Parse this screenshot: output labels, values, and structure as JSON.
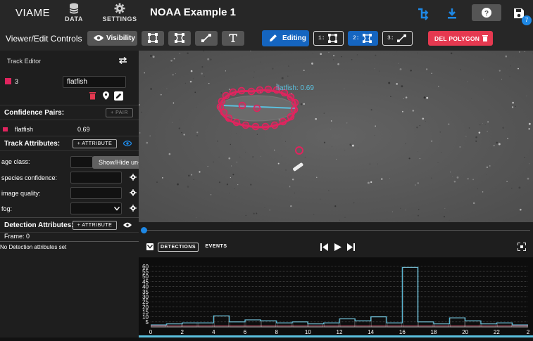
{
  "header": {
    "brand": "VIAME",
    "nav": [
      {
        "label": "DATA"
      },
      {
        "label": "SETTINGS"
      }
    ],
    "title": "NOAA Example 1",
    "badge": "7"
  },
  "toolbar": {
    "label": "Viewer/Edit Controls",
    "visibility_label": "Visibility",
    "editing_label": "Editing",
    "mode_buttons": [
      "1:",
      "2:",
      "3:"
    ],
    "delete_label": "DEL POLYGON"
  },
  "track_editor": {
    "title": "Track Editor",
    "track_id": "3",
    "track_type": "flatfish",
    "color": "#e0245e"
  },
  "confidence": {
    "title": "Confidence Pairs:",
    "add_label": "+ PAIR",
    "pairs": [
      {
        "name": "flatfish",
        "value": "0.69"
      }
    ]
  },
  "track_attributes": {
    "title": "Track Attributes:",
    "add_label": "+ ATTRIBUTE",
    "tooltip": "Show/Hide un-used",
    "items": [
      {
        "label": "age class:"
      },
      {
        "label": "species confidence:"
      },
      {
        "label": "image quality:"
      },
      {
        "label": "fog:"
      }
    ]
  },
  "detection_attributes": {
    "title": "Detection Attributes:",
    "add_label": "+ ATTRIBUTE",
    "frame": "Frame: 0",
    "empty": "No Detection attributes set"
  },
  "viewer": {
    "annotation_label": "flatfish: 0.69",
    "polygon_color": "#e0245e",
    "label_color": "#5bc0de"
  },
  "timeline": {
    "tabs": [
      "DETECTIONS",
      "EVENTS"
    ]
  },
  "chart_data": {
    "type": "line",
    "x": [
      0,
      1,
      2,
      3,
      4,
      5,
      6,
      7,
      8,
      9,
      10,
      11,
      12,
      13,
      14,
      15,
      16,
      17,
      18,
      19,
      20,
      21,
      22,
      23
    ],
    "series": [
      {
        "values": [
          2,
          3,
          4,
          4,
          11,
          5,
          7,
          6,
          4,
          5,
          3,
          4,
          8,
          6,
          10,
          4,
          59,
          5,
          3,
          9,
          6,
          3,
          4,
          2
        ]
      }
    ],
    "yticks": [
      5,
      10,
      15,
      20,
      25,
      30,
      35,
      40,
      45,
      50,
      55,
      60
    ],
    "xticks": [
      0,
      2,
      4,
      6,
      8,
      10,
      12,
      14,
      16,
      18,
      20,
      22,
      2
    ],
    "ylim": [
      0,
      62
    ],
    "xlim": [
      0,
      24
    ],
    "line_color": "#5bc0de",
    "secondary_color": "#ff6b8a"
  }
}
